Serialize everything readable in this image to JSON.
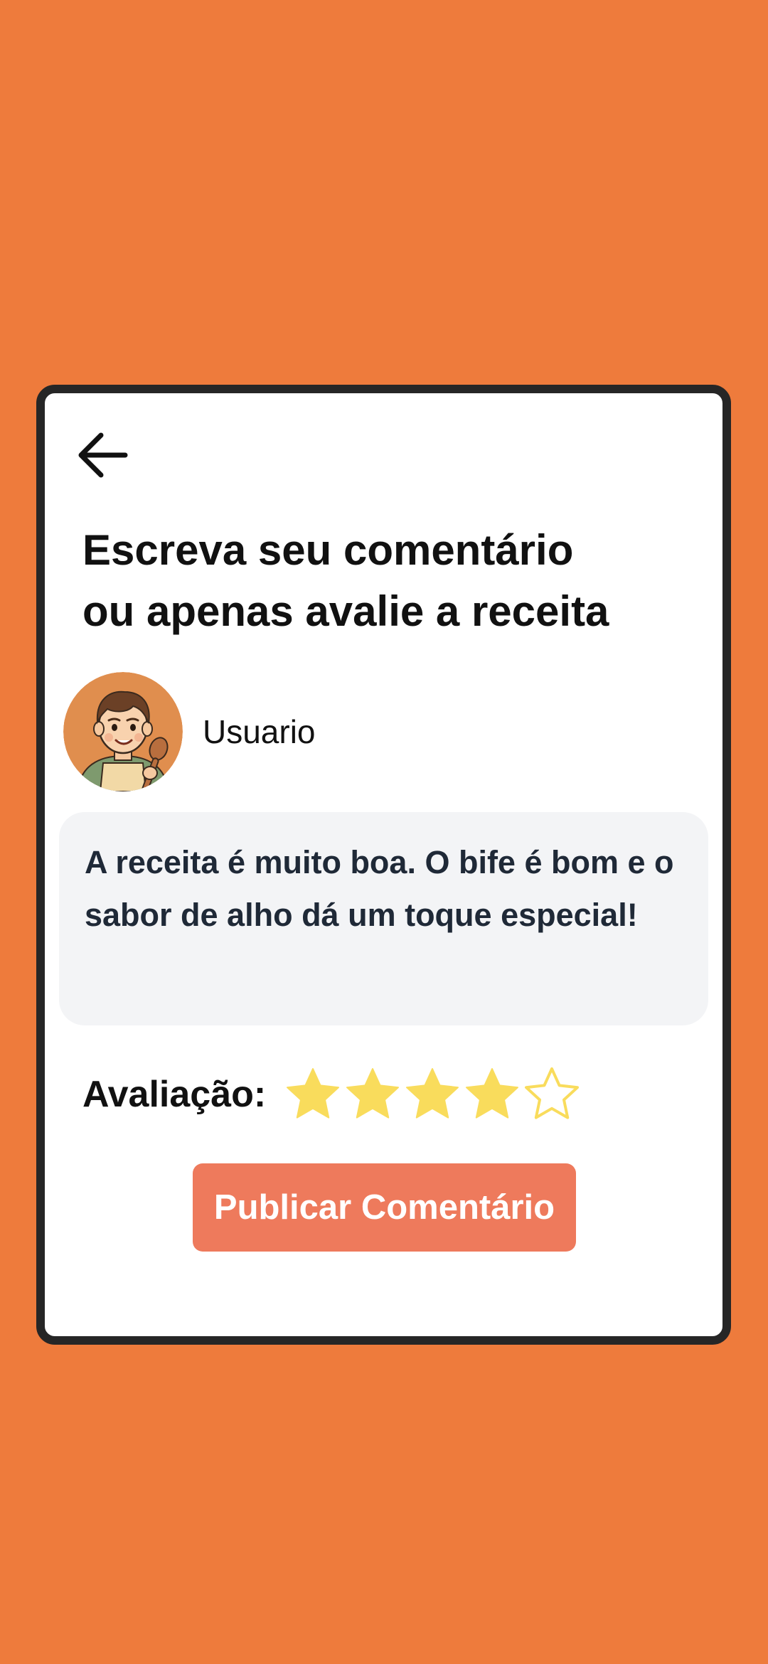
{
  "screen": {
    "title_line_1": "Escreva seu comentário",
    "title_line_2": "ou apenas avalie a receita",
    "back_icon": "arrow-left-icon"
  },
  "user": {
    "name": "Usuario",
    "avatar": "chef-avatar-illustration"
  },
  "comment": {
    "value": "A receita é muito boa. O bife é bom e o sabor de alho dá um toque especial!"
  },
  "rating": {
    "label": "Avaliação:",
    "value": 4,
    "max": 5,
    "star_icon": "star-icon",
    "filled_color": "#F9DC5C",
    "empty_color": "#F9DC5C"
  },
  "actions": {
    "publish_label": "Publicar Comentário"
  },
  "colors": {
    "background": "#EE7B3C",
    "card": "#FFFFFF",
    "card_border": "#262626",
    "comment_bg": "#F3F4F6",
    "button": "#EE7A5C"
  }
}
